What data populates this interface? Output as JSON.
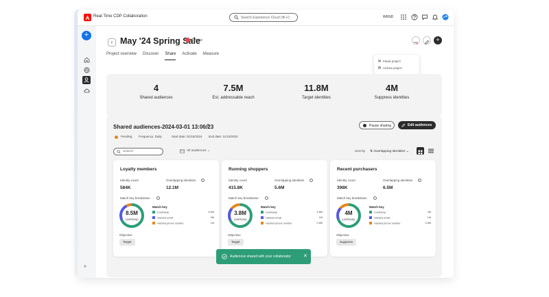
{
  "app": {
    "title": "Real-Time CDP Collaboration",
    "search_placeholder": "Search Experience Cloud (⌘+/)",
    "org": "WKND",
    "colors": {
      "accent": "#1473e6",
      "brand": "#fa0f00",
      "success": "#2d9d78"
    }
  },
  "sidenav": {
    "items": [
      "add-icon",
      "home-icon",
      "globe-icon",
      "people-icon",
      "cloud-icon"
    ],
    "expand_label": "»"
  },
  "header": {
    "back_label": "‹",
    "title": "May '24 Spring Sale",
    "owner": "TVtube",
    "tabs": [
      {
        "label": "Project overview",
        "active": false
      },
      {
        "label": "Discover",
        "active": false
      },
      {
        "label": "Share",
        "active": true
      },
      {
        "label": "Activate",
        "active": false
      },
      {
        "label": "Measure",
        "active": false
      }
    ],
    "add_label": "+"
  },
  "menu": {
    "items": [
      {
        "label": "Pause project",
        "icon": "pause-icon"
      },
      {
        "label": "Archive project",
        "icon": "archive-icon"
      }
    ]
  },
  "stats": [
    {
      "value": "4",
      "label": "Shared audiences"
    },
    {
      "value": "7.5M",
      "label": "Est. addressable reach"
    },
    {
      "value": "11.8M",
      "label": "Target identities"
    },
    {
      "value": "4M",
      "label": "Suppress identities"
    }
  ],
  "panel": {
    "title": "Shared audiences-2024-03-01 13:06:23",
    "status": "Pending",
    "frequency": "Frequency: Daily",
    "start": "Start date: 01/15/2024",
    "end": "End date: 11/15/2024",
    "pause_label": "Pause sharing",
    "edit_label": "Edit audiences",
    "search_placeholder": "Search",
    "filter_label": "All audiences",
    "sort_by": "Sort by",
    "sort_value": "Overlapping identities"
  },
  "cards": [
    {
      "name": "Loyalty members",
      "identity_count_label": "Identity count",
      "identity_count": "584K",
      "overlap_label": "Overlapping identities",
      "overlap": "12.1M",
      "breakdown_label": "Match key breakdown",
      "donut_value": "8.5M",
      "donut_sub": "LiveRamp",
      "match_key_label": "Match key",
      "keys": [
        {
          "label": "LiveRamp",
          "value": "8.5M",
          "color": "#2d9d78"
        },
        {
          "label": "Hashed email",
          "value": "3M",
          "color": "#5258e4"
        },
        {
          "label": "Hashed phone number",
          "value": "1M",
          "color": "#e68619"
        }
      ],
      "objective_label": "Objective",
      "objective": "Target"
    },
    {
      "name": "Running shoppers",
      "identity_count_label": "Identity count",
      "identity_count": "415.8K",
      "overlap_label": "Overlapping identities",
      "overlap": "5.6M",
      "breakdown_label": "Match key breakdown",
      "donut_value": "3.8M",
      "donut_sub": "LiveRamp",
      "match_key_label": "Match key",
      "keys": [
        {
          "label": "LiveRamp",
          "value": "3.8M",
          "color": "#2d9d78"
        },
        {
          "label": "Hashed email",
          "value": "1M",
          "color": "#5258e4"
        },
        {
          "label": "Hashed phone number",
          "value": "0.8M",
          "color": "#e68619"
        }
      ],
      "objective_label": "Objective",
      "objective": "Target"
    },
    {
      "name": "Recent purchasers",
      "identity_count_label": "Identity count",
      "identity_count": "398K",
      "overlap_label": "Overlapping identities",
      "overlap": "6.5M",
      "breakdown_label": "Match key breakdown",
      "donut_value": "4M",
      "donut_sub": "LiveRamp",
      "match_key_label": "Match key",
      "keys": [
        {
          "label": "LiveRamp",
          "value": "4M",
          "color": "#2d9d78"
        },
        {
          "label": "Hashed email",
          "value": "1M",
          "color": "#5258e4"
        },
        {
          "label": "Hashed phone number",
          "value": "0.8M",
          "color": "#e68619"
        }
      ],
      "objective_label": "Objective",
      "objective": "Suppress"
    }
  ],
  "toast": {
    "message": "Audiences shared with your collaborator",
    "close_label": "✕"
  }
}
